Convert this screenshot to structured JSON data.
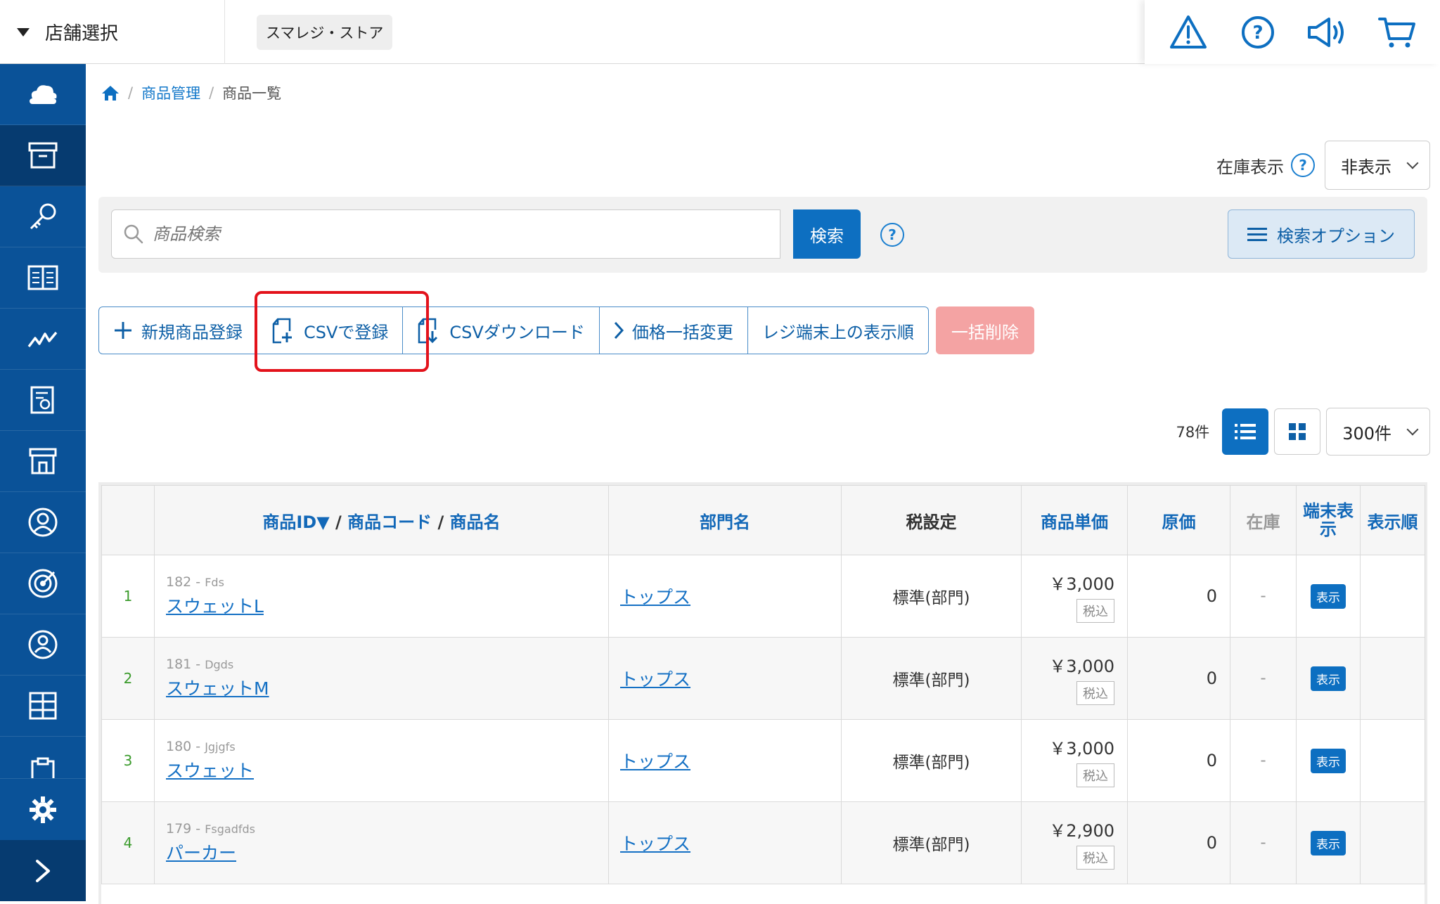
{
  "topbar": {
    "store_select_label": "店舗選択",
    "store_name": "スマレジ・ストア",
    "icons": [
      "warning-icon",
      "help-icon",
      "megaphone-icon",
      "cart-icon"
    ]
  },
  "sidebar": {
    "items": [
      "cloud-icon",
      "archive-box-icon",
      "key-icon",
      "book-icon",
      "chart-line-icon",
      "report-icon",
      "store-icon",
      "customer-icon",
      "target-icon",
      "member-icon",
      "grid-icon",
      "clipboard-icon"
    ],
    "active_index": 1,
    "bottom": [
      "gear-icon",
      "chevron-right-icon"
    ],
    "color": "#0a5298"
  },
  "breadcrumb": {
    "home": "home-icon",
    "level1": "商品管理",
    "level2": "商品一覧"
  },
  "stock_display": {
    "label": "在庫表示",
    "selected": "非表示"
  },
  "search": {
    "placeholder": "商品検索",
    "button": "検索",
    "options_button": "検索オプション"
  },
  "actions": {
    "new_product": "新規商品登録",
    "csv_register": "CSVで登録",
    "csv_download": "CSVダウンロード",
    "price_change": "価格一括変更",
    "display_order": "レジ端末上の表示順",
    "bulk_delete": "一括削除"
  },
  "list": {
    "count": "78件",
    "per_page": "300件"
  },
  "table": {
    "headers": {
      "id": "商品ID▼",
      "sep1": "/",
      "code": "商品コード",
      "sep2": "/",
      "name": "商品名",
      "dept": "部門名",
      "tax": "税設定",
      "price": "商品単価",
      "cost": "原価",
      "stock": "在庫",
      "terminal": "端末表示",
      "order": "表示順"
    },
    "rows": [
      {
        "no": "1",
        "pid": "182",
        "code": "Fds",
        "name": "スウェットL",
        "dept": "トップス",
        "tax": "標準(部門)",
        "price": "￥3,000",
        "tax_badge": "税込",
        "cost": "0",
        "stock": "-",
        "terminal": "表示"
      },
      {
        "no": "2",
        "pid": "181",
        "code": "Dgds",
        "name": "スウェットM",
        "dept": "トップス",
        "tax": "標準(部門)",
        "price": "￥3,000",
        "tax_badge": "税込",
        "cost": "0",
        "stock": "-",
        "terminal": "表示"
      },
      {
        "no": "3",
        "pid": "180",
        "code": "Jgjgfs",
        "name": "スウェット",
        "dept": "トップス",
        "tax": "標準(部門)",
        "price": "￥3,000",
        "tax_badge": "税込",
        "cost": "0",
        "stock": "-",
        "terminal": "表示"
      },
      {
        "no": "4",
        "pid": "179",
        "code": "Fsgadfds",
        "name": "パーカー",
        "dept": "トップス",
        "tax": "標準(部門)",
        "price": "￥2,900",
        "tax_badge": "税込",
        "cost": "0",
        "stock": "-",
        "terminal": "表示"
      }
    ]
  },
  "colors": {
    "accent": "#0d6fc1",
    "highlight": "#e3121b",
    "delete": "#f4a3a3"
  }
}
